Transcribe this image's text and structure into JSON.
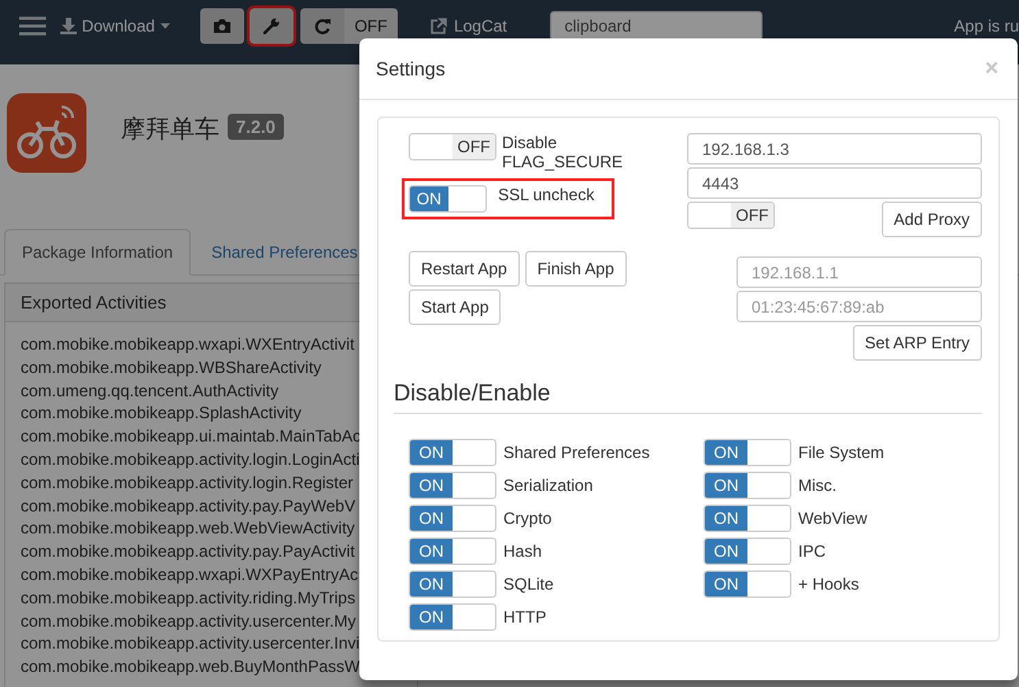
{
  "navbar": {
    "download": "Download",
    "tools": [
      {
        "kind": "camera",
        "highlighted": false
      },
      {
        "kind": "wrench",
        "highlighted": true
      }
    ],
    "sync": {
      "on": false,
      "switch_text": "OFF"
    },
    "logcat": "LogCat",
    "search": {
      "placeholder": "clipboard"
    },
    "status": "App is ru"
  },
  "app": {
    "name": "摩拜单车",
    "version": "7.2.0"
  },
  "tabs": [
    {
      "label": "Package Information",
      "selected": true
    },
    {
      "label": "Shared Preferences",
      "selected": false
    }
  ],
  "panel": {
    "title": "Exported Activities",
    "activities": [
      "com.mobike.mobikeapp.wxapi.WXEntryActivit",
      "com.mobike.mobikeapp.WBShareActivity",
      "com.umeng.qq.tencent.AuthActivity",
      "com.mobike.mobikeapp.SplashActivity",
      "com.mobike.mobikeapp.ui.maintab.MainTabAc",
      "com.mobike.mobikeapp.activity.login.LoginActi",
      "com.mobike.mobikeapp.activity.login.Register",
      "com.mobike.mobikeapp.activity.pay.PayWebV",
      "com.mobike.mobikeapp.web.WebViewActivity",
      "com.mobike.mobikeapp.activity.pay.PayActivit",
      "com.mobike.mobikeapp.wxapi.WXPayEntryAc",
      "com.mobike.mobikeapp.activity.riding.MyTrips",
      "com.mobike.mobikeapp.activity.usercenter.My",
      "com.mobike.mobikeapp.activity.usercenter.Invi",
      "com.mobike.mobikeapp.web.BuyMonthPassW"
    ]
  },
  "modal": {
    "title": "Settings",
    "close": "×",
    "options": [
      {
        "label": "Disable FLAG_SECURE",
        "on": false,
        "switch_text": "OFF",
        "highlighted": false
      },
      {
        "label": "SSL uncheck",
        "on": true,
        "switch_text": "ON",
        "highlighted": true
      }
    ],
    "proxy": {
      "host": "192.168.1.3",
      "port": "4443",
      "switch": {
        "on": false,
        "switch_text": "OFF"
      },
      "button": "Add Proxy"
    },
    "app_buttons": [
      "Restart App",
      "Finish App",
      "Start App"
    ],
    "arp": {
      "ip_placeholder": "192.168.1.1",
      "mac_placeholder": "01:23:45:67:89:ab",
      "button": "Set ARP Entry"
    },
    "section_title": "Disable/Enable",
    "hooks": [
      {
        "label": "Shared Preferences",
        "on": true,
        "switch_text": "ON"
      },
      {
        "label": "File System",
        "on": true,
        "switch_text": "ON"
      },
      {
        "label": "Serialization",
        "on": true,
        "switch_text": "ON"
      },
      {
        "label": "Misc.",
        "on": true,
        "switch_text": "ON"
      },
      {
        "label": "Crypto",
        "on": true,
        "switch_text": "ON"
      },
      {
        "label": "WebView",
        "on": true,
        "switch_text": "ON"
      },
      {
        "label": "Hash",
        "on": true,
        "switch_text": "ON"
      },
      {
        "label": "IPC",
        "on": true,
        "switch_text": "ON"
      },
      {
        "label": "SQLite",
        "on": true,
        "switch_text": "ON"
      },
      {
        "label": "+ Hooks",
        "on": true,
        "switch_text": "ON"
      },
      {
        "label": "HTTP",
        "on": true,
        "switch_text": "ON"
      }
    ]
  }
}
